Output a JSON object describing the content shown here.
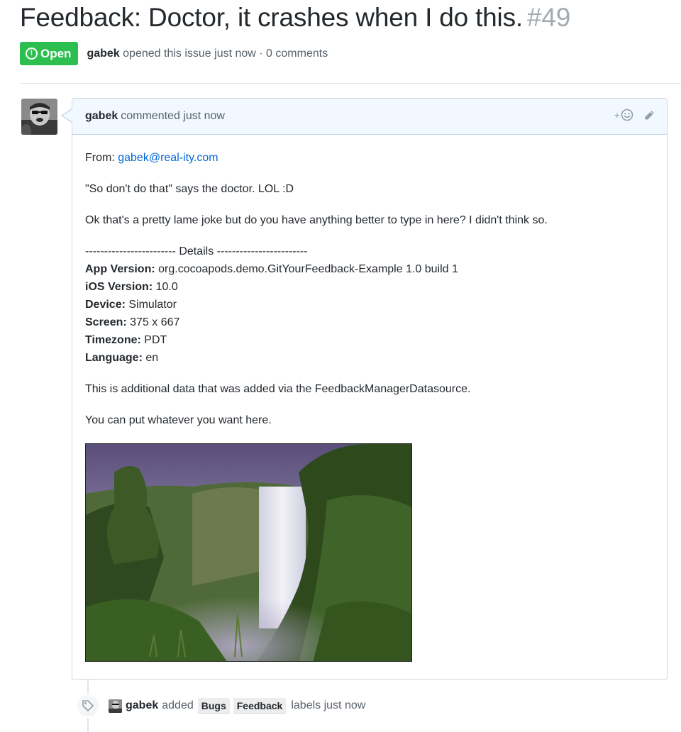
{
  "issue": {
    "title": "Feedback: Doctor, it crashes when I do this.",
    "number": "#49",
    "state": "Open",
    "author": "gabek",
    "opened_text": "opened this issue just now · 0 comments"
  },
  "comment": {
    "author": "gabek",
    "time": "commented just now",
    "from_label": "From:",
    "from_email": "gabek@real-ity.com",
    "line1": "\"So don't do that\" says the doctor. LOL :D",
    "line2": "Ok that's a pretty lame joke but do you have anything better to type in here? I didn't think so.",
    "details_header": "------------------------ Details ------------------------",
    "details": [
      {
        "label": "App Version:",
        "value": " org.cocoapods.demo.GitYourFeedback-Example 1.0 build 1"
      },
      {
        "label": "iOS Version:",
        "value": " 10.0"
      },
      {
        "label": "Device:",
        "value": " Simulator"
      },
      {
        "label": "Screen:",
        "value": " 375 x 667"
      },
      {
        "label": "Timezone:",
        "value": " PDT"
      },
      {
        "label": "Language:",
        "value": " en"
      }
    ],
    "additional": "This is additional data that was added via the FeedbackManagerDatasource.",
    "whatever": "You can put whatever you want here.",
    "react_plus": "+"
  },
  "event": {
    "actor": "gabek",
    "action": "added",
    "labels": [
      "Bugs",
      "Feedback"
    ],
    "suffix": "labels just now"
  },
  "colors": {
    "open_green": "#2cbe4e",
    "link_blue": "#0366d6",
    "header_blue": "#f1f8ff"
  },
  "icons": {
    "state": "issue-opened-icon",
    "react": "smiley-icon",
    "edit": "pencil-icon",
    "event": "tag-icon"
  }
}
